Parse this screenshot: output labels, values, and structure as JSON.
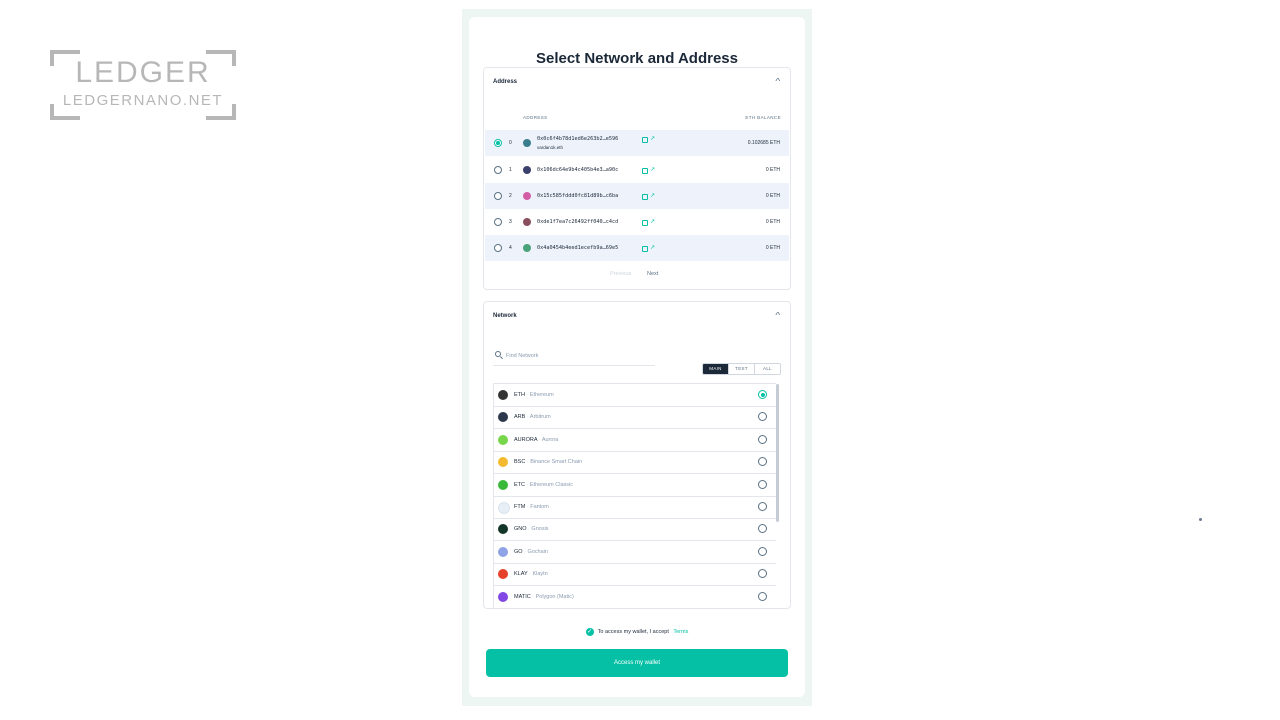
{
  "watermark": {
    "title": "LEDGER",
    "subtitle": "LEDGERNANO.NET"
  },
  "modal": {
    "title": "Select Network and Address"
  },
  "address_panel": {
    "title": "Address",
    "columns": {
      "address": "ADDRESS",
      "balance": "ETH BALANCE"
    },
    "rows": [
      {
        "index": "0",
        "address": "0x0c6f4b78d1ed6e263b2…e596",
        "ens": "vardan1k.eth",
        "balance": "0.102685 ETH",
        "selected": true,
        "avatar_color": "#3a7d8c"
      },
      {
        "index": "1",
        "address": "0x106dc64e9b4c405b4e3…a90c",
        "ens": "",
        "balance": "0 ETH",
        "selected": false,
        "avatar_color": "#3b3f6b"
      },
      {
        "index": "2",
        "address": "0x15c585fddd0fc81d89b…c6ba",
        "ens": "",
        "balance": "0 ETH",
        "selected": false,
        "avatar_color": "#d25fa6"
      },
      {
        "index": "3",
        "address": "0xde1f7ea7c26492ff040…c4cd",
        "ens": "",
        "balance": "0 ETH",
        "selected": false,
        "avatar_color": "#8a4f5e"
      },
      {
        "index": "4",
        "address": "0x4a0454b4eed1ecefb9a…69e5",
        "ens": "",
        "balance": "0 ETH",
        "selected": false,
        "avatar_color": "#4aa27a"
      }
    ],
    "pagination": {
      "previous": "Previous",
      "next": "Next"
    }
  },
  "network_panel": {
    "title": "Network",
    "search_placeholder": "Find Network",
    "filters": [
      "MAIN",
      "TEST",
      "ALL"
    ],
    "active_filter": "MAIN",
    "networks": [
      {
        "symbol": "ETH",
        "name": "Ethereum",
        "selected": true,
        "icon": "ethereum-icon",
        "color": "#343434"
      },
      {
        "symbol": "ARB",
        "name": "Arbitrum",
        "selected": false,
        "icon": "arbitrum-icon",
        "color": "#2d374b"
      },
      {
        "symbol": "AURORA",
        "name": "Aurora",
        "selected": false,
        "icon": "aurora-icon",
        "color": "#78d64b"
      },
      {
        "symbol": "BSC",
        "name": "Binance Smart Chain",
        "selected": false,
        "icon": "binance-icon",
        "color": "#f3ba2f"
      },
      {
        "symbol": "ETC",
        "name": "Ethereum Classic",
        "selected": false,
        "icon": "ethereum-classic-icon",
        "color": "#3ab83a"
      },
      {
        "symbol": "FTM",
        "name": "Fantom",
        "selected": false,
        "icon": "fantom-icon",
        "color": "#e8eef5"
      },
      {
        "symbol": "GNO",
        "name": "Gnosis",
        "selected": false,
        "icon": "gnosis-icon",
        "color": "#133629"
      },
      {
        "symbol": "GO",
        "name": "Gochain",
        "selected": false,
        "icon": "gochain-icon",
        "color": "#8fa3e6"
      },
      {
        "symbol": "KLAY",
        "name": "Klaytn",
        "selected": false,
        "icon": "klaytn-icon",
        "color": "#e6412a"
      },
      {
        "symbol": "MATIC",
        "name": "Polygon (Matic)",
        "selected": false,
        "icon": "polygon-icon",
        "color": "#8247e5"
      }
    ]
  },
  "terms": {
    "text": "To access my wallet, I accept",
    "link": "Terms"
  },
  "access_button": {
    "label": "Access my wallet"
  },
  "colors": {
    "accent": "#05c0a5",
    "text": "#1b2838",
    "row_highlight": "#eef3fb"
  }
}
